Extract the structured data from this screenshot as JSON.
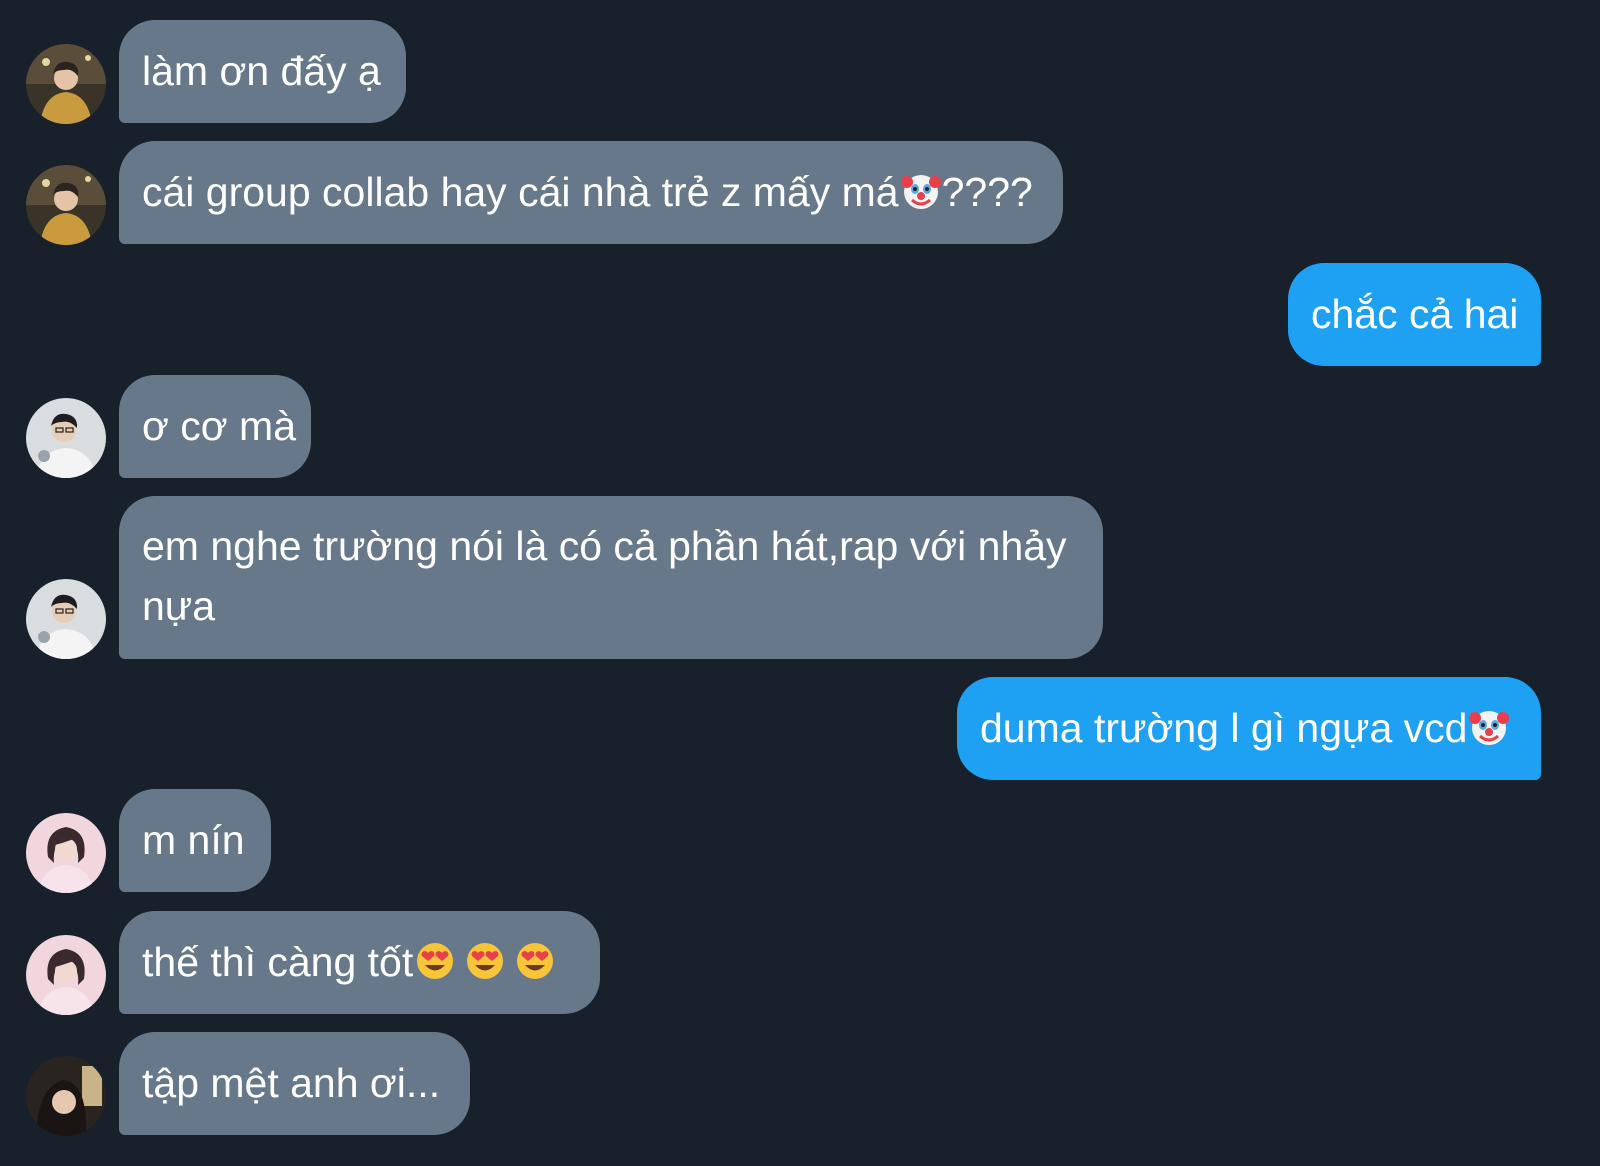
{
  "messages": [
    {
      "id": 1,
      "side": "in",
      "sender": "user1",
      "text": "làm ơn đấy ạ",
      "emoji": []
    },
    {
      "id": 2,
      "side": "in",
      "sender": "user1",
      "text": "cái group collab hay cái nhà trẻ z mấy má",
      "emoji": [
        "clown-face"
      ],
      "suffix": "????"
    },
    {
      "id": 3,
      "side": "out",
      "sender": "me",
      "text": "chắc cả hai",
      "emoji": []
    },
    {
      "id": 4,
      "side": "in",
      "sender": "user2",
      "text": "ơ cơ mà",
      "emoji": []
    },
    {
      "id": 5,
      "side": "in",
      "sender": "user2",
      "text": "em nghe trường nói là có cả phần hát,rap với nhảy nựa",
      "emoji": []
    },
    {
      "id": 6,
      "side": "out",
      "sender": "me",
      "text": "duma trường l gì ngựa vcd",
      "emoji": [
        "clown-face"
      ]
    },
    {
      "id": 7,
      "side": "in",
      "sender": "user3",
      "text": "m nín",
      "emoji": []
    },
    {
      "id": 8,
      "side": "in",
      "sender": "user3",
      "text": "thế thì càng tốt",
      "emoji": [
        "heart-eyes-face",
        "heart-eyes-face",
        "heart-eyes-face"
      ]
    },
    {
      "id": 9,
      "side": "in",
      "sender": "user4",
      "text": "tập mệt anh ơi...",
      "emoji": []
    }
  ],
  "colors": {
    "background": "#17202b",
    "incoming_bubble": "#66788a",
    "outgoing_bubble": "#1ea1f2",
    "text": "#ffffff"
  }
}
